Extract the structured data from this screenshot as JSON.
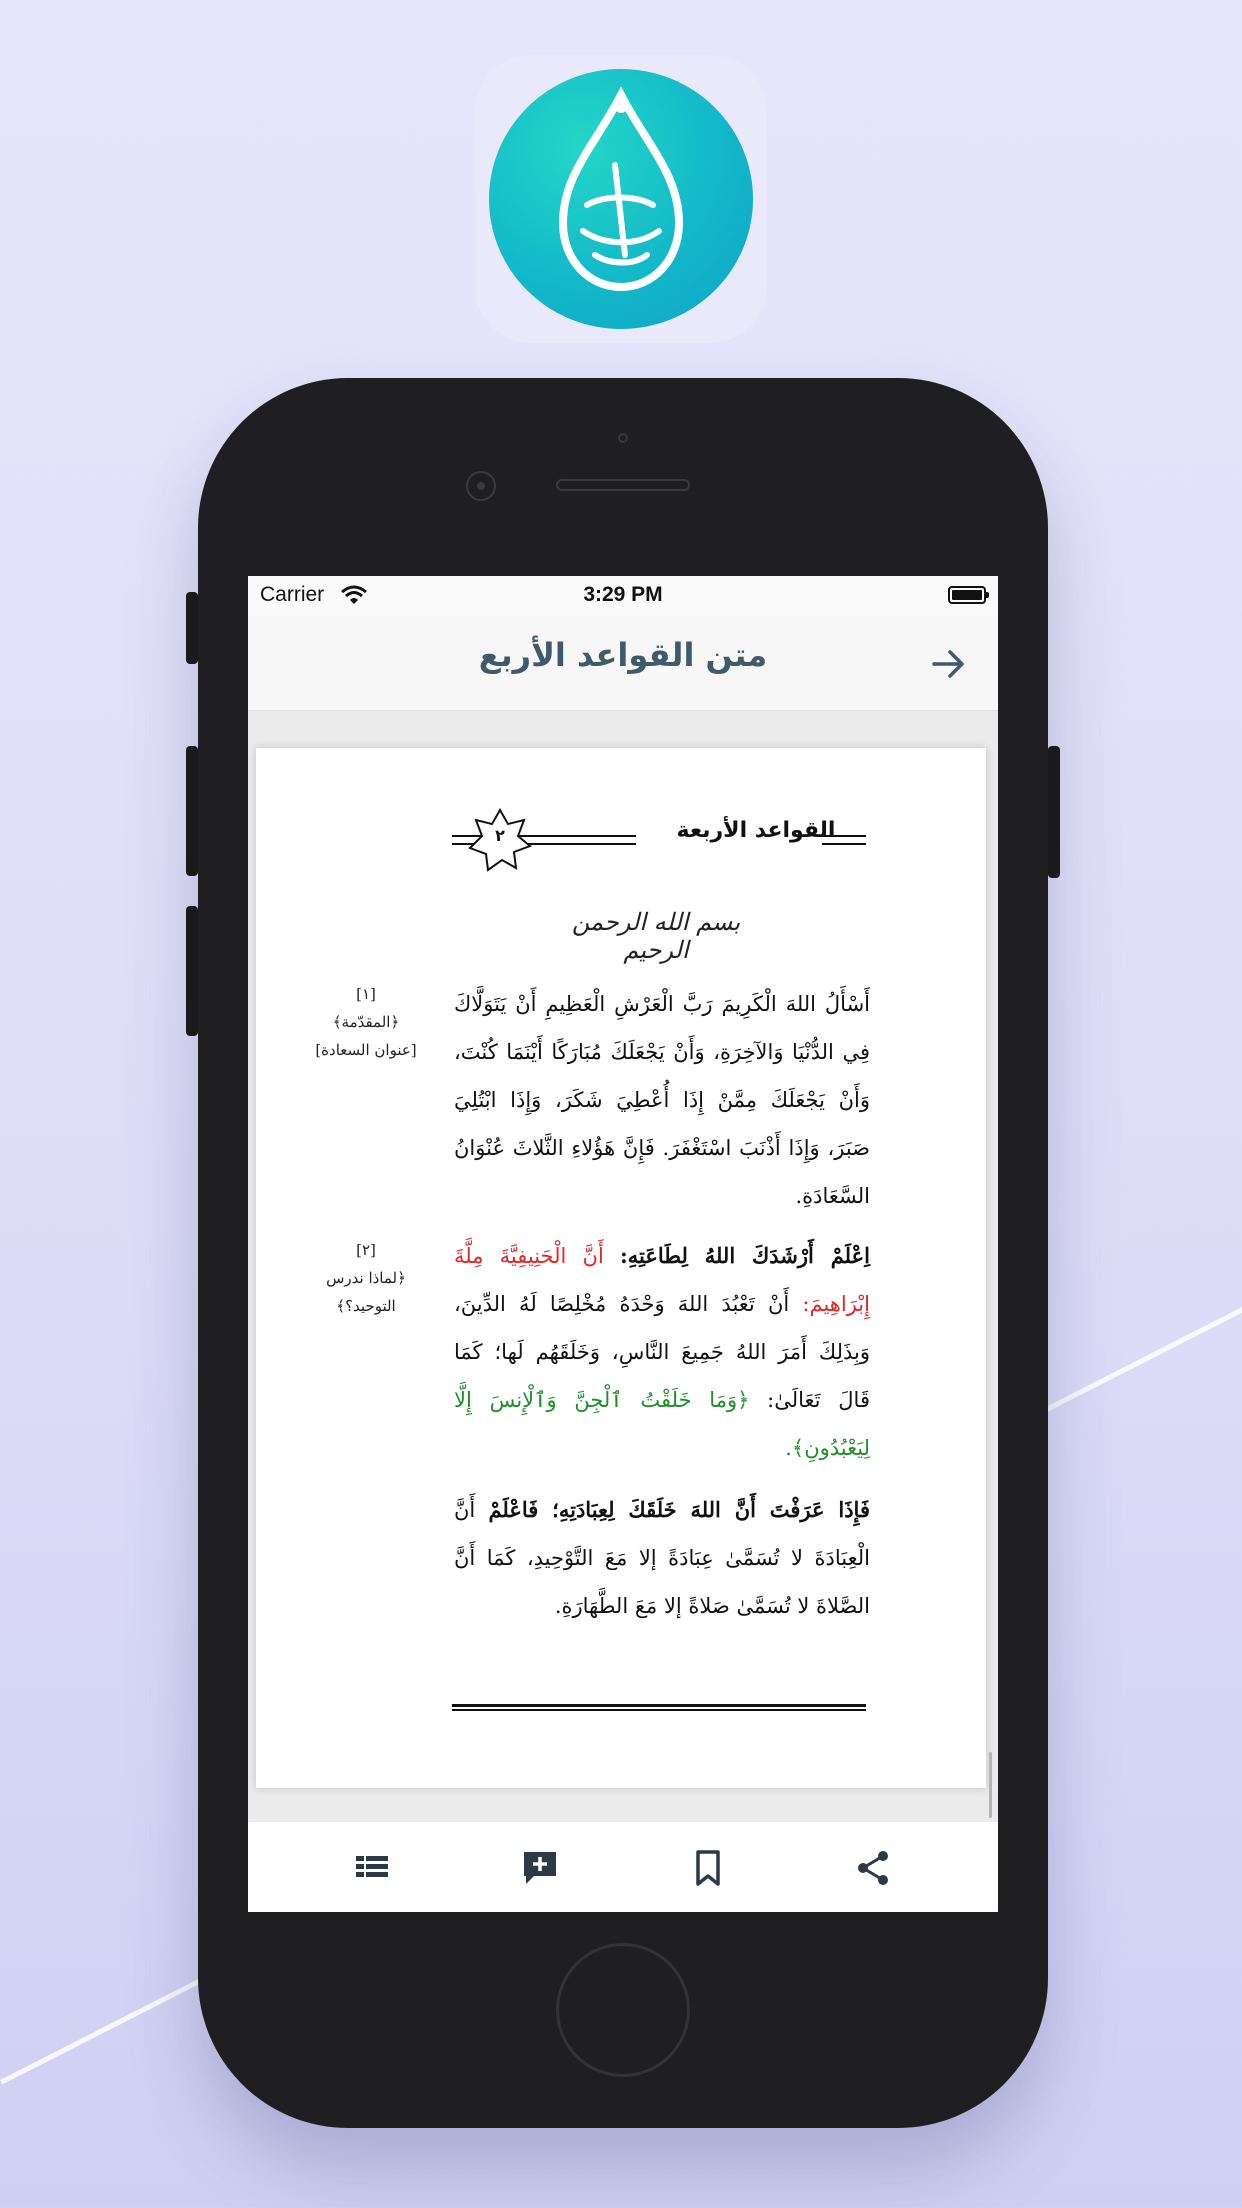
{
  "status_bar": {
    "carrier": "Carrier",
    "time": "3:29 PM"
  },
  "nav": {
    "title": "متن القواعد الأربع",
    "back_icon": "arrow-right-icon"
  },
  "page": {
    "header_text": "القواعد الأربعة",
    "page_number": "٢",
    "basmala": "بسم الله الرحمن الرحيم",
    "notes": [
      {
        "number": "[١]",
        "line1": "﴿المقدّمة﴾",
        "line2": "[عنوان السعادة]"
      },
      {
        "number": "[٢]",
        "line1": "﴿لماذا ندرس",
        "line2": "التوحيد؟﴾"
      }
    ],
    "para1": "أَسْأَلُ اللهَ الْكَرِيمَ رَبَّ الْعَرْشِ الْعَظِيمِ أَنْ يَتَوَلَّاكَ فِي الدُّنْيَا وَالآخِرَةِ، وَأَنْ يَجْعَلَكَ مُبَارَكًا أَيْنَمَا كُنْتَ، وَأَنْ يَجْعَلَكَ مِمَّنْ إِذَا أُعْطِيَ شَكَرَ، وَإِذَا ابْتُلِيَ صَبَرَ، وَإِذَا أَذْنَبَ اسْتَغْفَرَ. فَإِنَّ هَؤُلاءِ الثَّلاثَ عُنْوَانُ السَّعَادَةِ.",
    "para2": {
      "lead": "اِعْلَمْ أَرْشَدَكَ اللهُ لِطَاعَتِهِ:",
      "red": "أَنَّ الْحَنِيفِيَّةَ مِلَّةَ إِبْرَاهِيمَ:",
      "body": "أَنْ تَعْبُدَ اللهَ وَحْدَهُ مُخْلِصًا لَهُ الدِّينَ، وَبِذَلِكَ أَمَرَ اللهُ جَمِيعَ النَّاسِ، وَخَلَقَهُم لَها؛ كَمَا قَالَ تَعَالَىٰ:",
      "green": "﴿وَمَا خَلَقْتُ ٱلْجِنَّ وَٱلْإِنسَ إِلَّا لِيَعْبُدُونِ﴾."
    },
    "para3": {
      "lead": "فَإِذَا عَرَفْتَ أَنَّ اللهَ خَلَقَكَ لِعِبَادَتِهِ؛ فَاعْلَمْ",
      "body": "أَنَّ الْعِبَادَةَ لا تُسَمَّىٰ عِبَادَةً إلا مَعَ التَّوْحِيدِ، كَمَا أَنَّ الصَّلاةَ لا تُسَمَّىٰ صَلاةً إلا مَعَ الطَّهَارَةِ."
    }
  },
  "tab_bar": {
    "items": [
      {
        "name": "table-of-contents-icon"
      },
      {
        "name": "add-note-icon"
      },
      {
        "name": "bookmark-icon"
      },
      {
        "name": "share-icon"
      }
    ]
  },
  "colors": {
    "accent": "#3f5a6a",
    "highlight_red": "#e02828",
    "highlight_green": "#1f8f2a",
    "icon_teal": "#13b8c9"
  }
}
